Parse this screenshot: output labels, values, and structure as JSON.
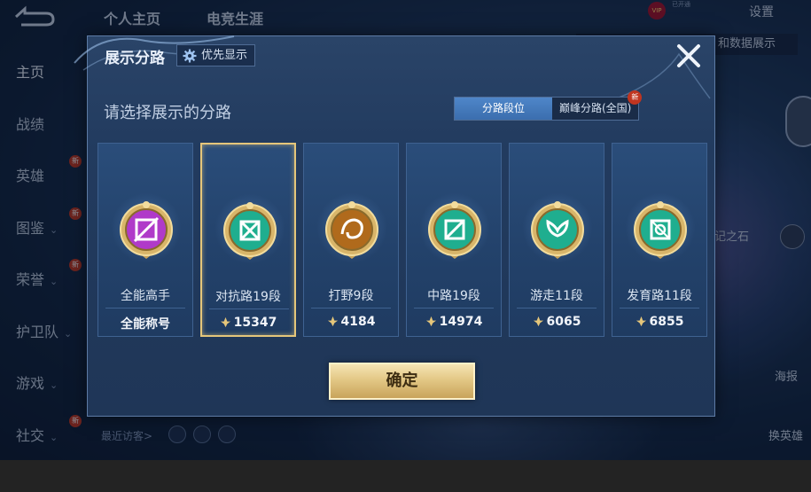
{
  "top_nav": {
    "tabs": [
      "个人主页",
      "电竞生涯"
    ],
    "settings_label": "设置",
    "vip_label": "VIP",
    "vip_status": "已开通",
    "data_show_label": "和数据展示"
  },
  "sidebar": {
    "items": [
      {
        "label": "主页",
        "chevron": false,
        "new": false
      },
      {
        "label": "战绩",
        "chevron": false,
        "new": false
      },
      {
        "label": "英雄",
        "chevron": false,
        "new": true
      },
      {
        "label": "图鉴",
        "chevron": true,
        "new": true
      },
      {
        "label": "荣誉",
        "chevron": true,
        "new": true
      },
      {
        "label": "护卫队",
        "chevron": true,
        "new": false
      },
      {
        "label": "游戏",
        "chevron": true,
        "new": false
      },
      {
        "label": "社交",
        "chevron": true,
        "new": true
      }
    ],
    "new_badge_text": "新"
  },
  "recent_visitors_label": "最近访客>",
  "right_side": {
    "label1": "记之石",
    "label2": "海报",
    "label3": "换英雄"
  },
  "modal": {
    "title": "展示分路",
    "priority_label": "优先显示",
    "subtitle": "请选择展示的分路",
    "segments": [
      {
        "label": "分路段位",
        "active": true
      },
      {
        "label": "巅峰分路(全国)",
        "active": false,
        "new": true
      }
    ],
    "new_badge_text": "新",
    "cards": [
      {
        "name": "全能高手",
        "score": "全能称号",
        "score_icon": false,
        "emblem": "all-round",
        "color": "#b03ac9",
        "selected": false
      },
      {
        "name": "对抗路19段",
        "score": "15347",
        "score_icon": true,
        "emblem": "clash-lane",
        "color": "#1fae8f",
        "selected": true
      },
      {
        "name": "打野9段",
        "score": "4184",
        "score_icon": true,
        "emblem": "jungle",
        "color": "#b06a1c",
        "selected": false
      },
      {
        "name": "中路19段",
        "score": "14974",
        "score_icon": true,
        "emblem": "mid-lane",
        "color": "#1fae8f",
        "selected": false
      },
      {
        "name": "游走11段",
        "score": "6065",
        "score_icon": true,
        "emblem": "roam",
        "color": "#1fae8f",
        "selected": false
      },
      {
        "name": "发育路11段",
        "score": "6855",
        "score_icon": true,
        "emblem": "farm-lane",
        "color": "#1fae8f",
        "selected": false
      }
    ],
    "confirm_label": "确定"
  },
  "colors": {
    "accent_gold": "#e5c67a",
    "panel_blue": "#223b5f",
    "active_segment": "#4f86c9"
  }
}
